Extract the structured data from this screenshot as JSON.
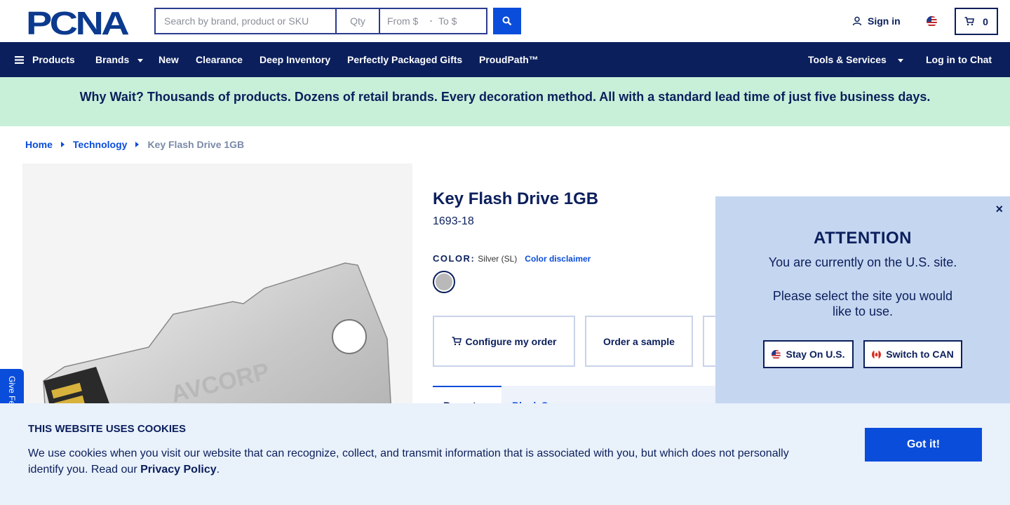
{
  "header": {
    "logo_text": "PCNA",
    "search": {
      "placeholder": "Search by brand, product or SKU"
    },
    "qty": {
      "placeholder": "Qty"
    },
    "price_from": {
      "placeholder": "From $"
    },
    "price_to": {
      "placeholder": "To $"
    },
    "signin_label": "Sign in",
    "cart_count": "0"
  },
  "nav": {
    "products": "Products",
    "brands": "Brands",
    "new": "New",
    "clearance": "Clearance",
    "deep_inventory": "Deep Inventory",
    "packaged_gifts": "Perfectly Packaged Gifts",
    "proudpath": "ProudPath™",
    "tools": "Tools & Services",
    "chat": "Log in to Chat"
  },
  "banner": {
    "text": "Why Wait? Thousands of products. Dozens of retail brands. Every decoration method. All with a standard lead time of just five business days."
  },
  "breadcrumb": {
    "home": "Home",
    "category": "Technology",
    "current": "Key Flash Drive 1GB"
  },
  "product": {
    "title": "Key Flash Drive 1GB",
    "sku": "1693-18",
    "color_label": "COLOR:",
    "color_value": "Silver (SL)",
    "color_disclaimer": "Color disclaimer",
    "swatch_color": "#b9b9b9",
    "image_brand": "AVCORP",
    "actions": {
      "configure": "Configure my order",
      "sample": "Order a sample"
    },
    "tabs": {
      "active": "Recent",
      "second": "Blank Samp"
    }
  },
  "modal": {
    "title": "ATTENTION",
    "line1": "You are currently on the U.S. site.",
    "line2": "Please select the site you would like to use.",
    "stay": "Stay On U.S.",
    "switch": "Switch to CAN",
    "close": "×"
  },
  "feedback": {
    "label": "Give Fe"
  },
  "cookie": {
    "title": "THIS WEBSITE USES COOKIES",
    "text": "We use cookies when you visit our website that can recognize, collect, and transmit information that is associated with you, but which does not personally identify you. Read our",
    "link": "Privacy Policy",
    "end": ".",
    "button": "Got it!"
  },
  "colors": {
    "navy": "#0b1f5c",
    "blue": "#0a4ddb",
    "banner": "#c8f0d9",
    "modal": "#c5d6f0",
    "cookie": "#e9f1fb"
  }
}
